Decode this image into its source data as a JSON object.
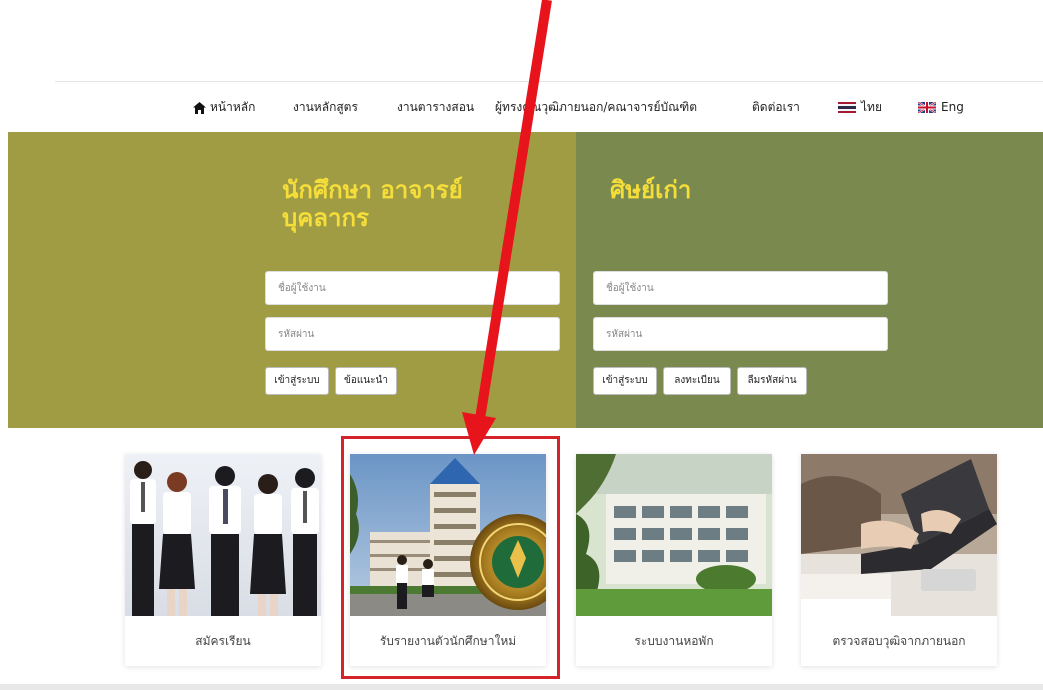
{
  "nav": {
    "items": [
      {
        "label": "หน้าหลัก",
        "icon": "home-icon"
      },
      {
        "label": "งานหลักสูตร"
      },
      {
        "label": "งานตารางสอน"
      },
      {
        "label": "ผู้ทรงคุณวุฒิภายนอก/คณาจารย์บัณฑิต"
      },
      {
        "label": "ติดต่อเรา"
      },
      {
        "label": "ไทย",
        "icon": "thai-flag-icon"
      },
      {
        "label": "Eng",
        "icon": "uk-flag-icon"
      }
    ]
  },
  "login_student": {
    "title_line1": "นักศึกษา อาจารย์",
    "title_line2": "บุคลากร",
    "username_placeholder": "ชื่อผู้ใช้งาน",
    "password_placeholder": "รหัสผ่าน",
    "login_button": "เข้าสู่ระบบ",
    "guide_button": "ข้อแนะนำ"
  },
  "login_alumni": {
    "title": "ศิษย์เก่า",
    "username_placeholder": "ชื่อผู้ใช้งาน",
    "password_placeholder": "รหัสผ่าน",
    "login_button": "เข้าสู่ระบบ",
    "register_button": "ลงทะเบียน",
    "forgot_button": "ลืมรหัสผ่าน"
  },
  "cards": [
    {
      "label": "สมัครเรียน"
    },
    {
      "label": "รับรายงานตัวนักศึกษาใหม่"
    },
    {
      "label": "ระบบงานหอพัก"
    },
    {
      "label": "ตรวจสอบวุฒิจากภายนอก"
    }
  ],
  "colors": {
    "panel_left": "#a09c44",
    "panel_right": "#7a8a4f",
    "title_yellow": "#f5de3a",
    "annotation_red": "#e8141c"
  }
}
